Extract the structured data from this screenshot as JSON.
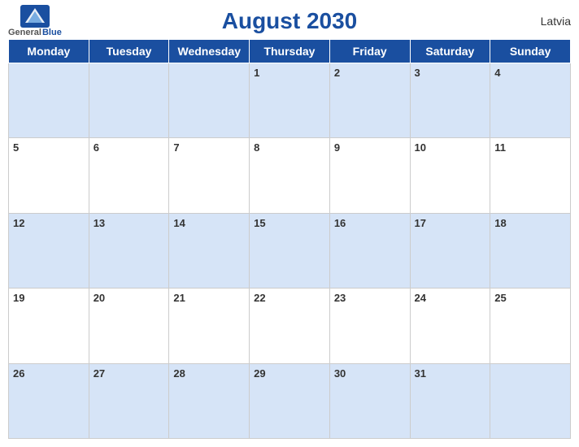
{
  "header": {
    "title": "August 2030",
    "country": "Latvia",
    "logo_general": "General",
    "logo_blue": "Blue"
  },
  "weekdays": [
    "Monday",
    "Tuesday",
    "Wednesday",
    "Thursday",
    "Friday",
    "Saturday",
    "Sunday"
  ],
  "weeks": [
    [
      "",
      "",
      "",
      "1",
      "2",
      "3",
      "4"
    ],
    [
      "5",
      "6",
      "7",
      "8",
      "9",
      "10",
      "11"
    ],
    [
      "12",
      "13",
      "14",
      "15",
      "16",
      "17",
      "18"
    ],
    [
      "19",
      "20",
      "21",
      "22",
      "23",
      "24",
      "25"
    ],
    [
      "26",
      "27",
      "28",
      "29",
      "30",
      "31",
      ""
    ]
  ]
}
